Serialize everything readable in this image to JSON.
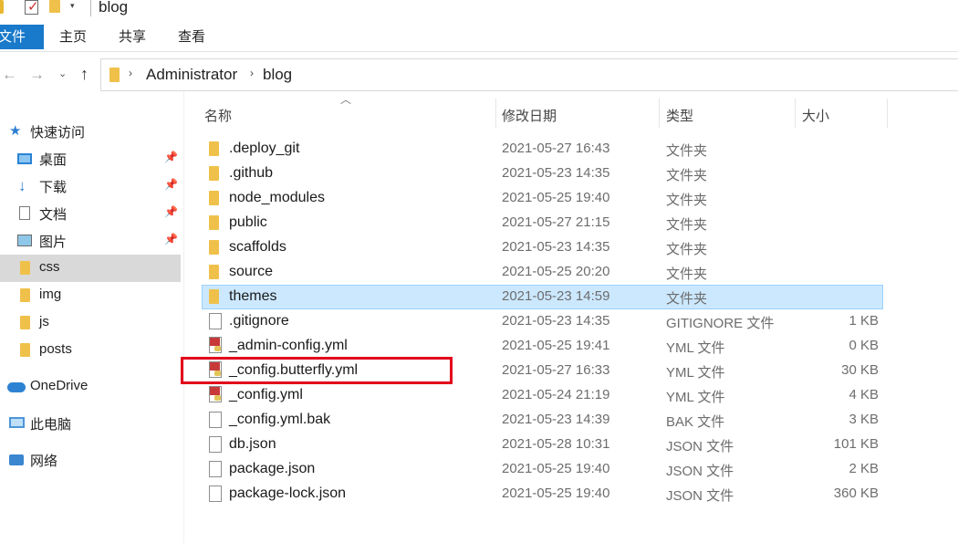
{
  "window": {
    "title": "blog"
  },
  "ribbon": {
    "tabs": [
      {
        "label": "文件"
      },
      {
        "label": "主页"
      },
      {
        "label": "共享"
      },
      {
        "label": "查看"
      }
    ]
  },
  "address": {
    "breadcrumb": [
      "Administrator",
      "blog"
    ]
  },
  "nav": {
    "items": [
      {
        "label": "快速访问",
        "icon": "star-icon"
      },
      {
        "label": "桌面",
        "icon": "desktop-icon",
        "pinned": true
      },
      {
        "label": "下载",
        "icon": "download-icon",
        "pinned": true
      },
      {
        "label": "文档",
        "icon": "document-icon",
        "pinned": true
      },
      {
        "label": "图片",
        "icon": "picture-icon",
        "pinned": true
      },
      {
        "label": "css",
        "icon": "folder-icon",
        "selected": true
      },
      {
        "label": "img",
        "icon": "folder-icon"
      },
      {
        "label": "js",
        "icon": "folder-icon"
      },
      {
        "label": "posts",
        "icon": "folder-icon"
      },
      {
        "label": "OneDrive",
        "icon": "cloud-icon"
      },
      {
        "label": "此电脑",
        "icon": "computer-icon"
      },
      {
        "label": "网络",
        "icon": "network-icon"
      }
    ]
  },
  "columns": {
    "name": "名称",
    "date": "修改日期",
    "type": "类型",
    "size": "大小"
  },
  "files": [
    {
      "name": ".deploy_git",
      "date": "2021-05-27 16:43",
      "type": "文件夹",
      "size": "",
      "icon": "folder-icon"
    },
    {
      "name": ".github",
      "date": "2021-05-23 14:35",
      "type": "文件夹",
      "size": "",
      "icon": "folder-icon"
    },
    {
      "name": "node_modules",
      "date": "2021-05-25 19:40",
      "type": "文件夹",
      "size": "",
      "icon": "folder-icon"
    },
    {
      "name": "public",
      "date": "2021-05-27 21:15",
      "type": "文件夹",
      "size": "",
      "icon": "folder-icon"
    },
    {
      "name": "scaffolds",
      "date": "2021-05-23 14:35",
      "type": "文件夹",
      "size": "",
      "icon": "folder-icon"
    },
    {
      "name": "source",
      "date": "2021-05-25 20:20",
      "type": "文件夹",
      "size": "",
      "icon": "folder-icon"
    },
    {
      "name": "themes",
      "date": "2021-05-23 14:59",
      "type": "文件夹",
      "size": "",
      "icon": "folder-icon",
      "selected": true
    },
    {
      "name": ".gitignore",
      "date": "2021-05-23 14:35",
      "type": "GITIGNORE 文件",
      "size": "1 KB",
      "icon": "file-icon"
    },
    {
      "name": "_admin-config.yml",
      "date": "2021-05-25 19:41",
      "type": "YML 文件",
      "size": "0 KB",
      "icon": "yml-file-icon"
    },
    {
      "name": "_config.butterfly.yml",
      "date": "2021-05-27 16:33",
      "type": "YML 文件",
      "size": "30 KB",
      "icon": "yml-file-icon",
      "highlighted": true
    },
    {
      "name": "_config.yml",
      "date": "2021-05-24 21:19",
      "type": "YML 文件",
      "size": "4 KB",
      "icon": "yml-file-icon"
    },
    {
      "name": "_config.yml.bak",
      "date": "2021-05-23 14:39",
      "type": "BAK 文件",
      "size": "3 KB",
      "icon": "file-icon"
    },
    {
      "name": "db.json",
      "date": "2021-05-28 10:31",
      "type": "JSON 文件",
      "size": "101 KB",
      "icon": "file-icon"
    },
    {
      "name": "package.json",
      "date": "2021-05-25 19:40",
      "type": "JSON 文件",
      "size": "2 KB",
      "icon": "file-icon"
    },
    {
      "name": "package-lock.json",
      "date": "2021-05-25 19:40",
      "type": "JSON 文件",
      "size": "360 KB",
      "icon": "file-icon"
    }
  ],
  "colors": {
    "accent": "#1979ca",
    "selection": "#cce8ff",
    "highlight_box": "#e3001b"
  }
}
